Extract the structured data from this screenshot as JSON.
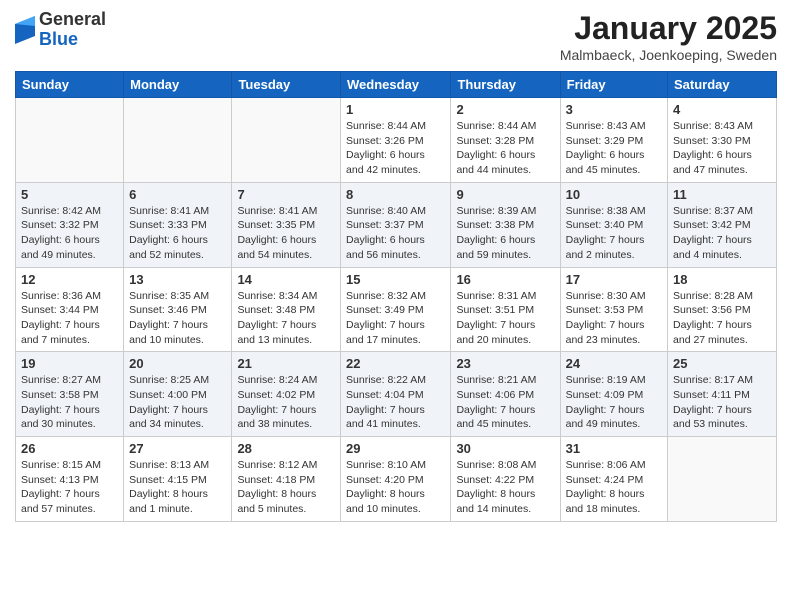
{
  "header": {
    "logo_general": "General",
    "logo_blue": "Blue",
    "month_title": "January 2025",
    "location": "Malmbaeck, Joenkoeping, Sweden"
  },
  "weekdays": [
    "Sunday",
    "Monday",
    "Tuesday",
    "Wednesday",
    "Thursday",
    "Friday",
    "Saturday"
  ],
  "weeks": [
    [
      {
        "day": "",
        "info": ""
      },
      {
        "day": "",
        "info": ""
      },
      {
        "day": "",
        "info": ""
      },
      {
        "day": "1",
        "info": "Sunrise: 8:44 AM\nSunset: 3:26 PM\nDaylight: 6 hours\nand 42 minutes."
      },
      {
        "day": "2",
        "info": "Sunrise: 8:44 AM\nSunset: 3:28 PM\nDaylight: 6 hours\nand 44 minutes."
      },
      {
        "day": "3",
        "info": "Sunrise: 8:43 AM\nSunset: 3:29 PM\nDaylight: 6 hours\nand 45 minutes."
      },
      {
        "day": "4",
        "info": "Sunrise: 8:43 AM\nSunset: 3:30 PM\nDaylight: 6 hours\nand 47 minutes."
      }
    ],
    [
      {
        "day": "5",
        "info": "Sunrise: 8:42 AM\nSunset: 3:32 PM\nDaylight: 6 hours\nand 49 minutes."
      },
      {
        "day": "6",
        "info": "Sunrise: 8:41 AM\nSunset: 3:33 PM\nDaylight: 6 hours\nand 52 minutes."
      },
      {
        "day": "7",
        "info": "Sunrise: 8:41 AM\nSunset: 3:35 PM\nDaylight: 6 hours\nand 54 minutes."
      },
      {
        "day": "8",
        "info": "Sunrise: 8:40 AM\nSunset: 3:37 PM\nDaylight: 6 hours\nand 56 minutes."
      },
      {
        "day": "9",
        "info": "Sunrise: 8:39 AM\nSunset: 3:38 PM\nDaylight: 6 hours\nand 59 minutes."
      },
      {
        "day": "10",
        "info": "Sunrise: 8:38 AM\nSunset: 3:40 PM\nDaylight: 7 hours\nand 2 minutes."
      },
      {
        "day": "11",
        "info": "Sunrise: 8:37 AM\nSunset: 3:42 PM\nDaylight: 7 hours\nand 4 minutes."
      }
    ],
    [
      {
        "day": "12",
        "info": "Sunrise: 8:36 AM\nSunset: 3:44 PM\nDaylight: 7 hours\nand 7 minutes."
      },
      {
        "day": "13",
        "info": "Sunrise: 8:35 AM\nSunset: 3:46 PM\nDaylight: 7 hours\nand 10 minutes."
      },
      {
        "day": "14",
        "info": "Sunrise: 8:34 AM\nSunset: 3:48 PM\nDaylight: 7 hours\nand 13 minutes."
      },
      {
        "day": "15",
        "info": "Sunrise: 8:32 AM\nSunset: 3:49 PM\nDaylight: 7 hours\nand 17 minutes."
      },
      {
        "day": "16",
        "info": "Sunrise: 8:31 AM\nSunset: 3:51 PM\nDaylight: 7 hours\nand 20 minutes."
      },
      {
        "day": "17",
        "info": "Sunrise: 8:30 AM\nSunset: 3:53 PM\nDaylight: 7 hours\nand 23 minutes."
      },
      {
        "day": "18",
        "info": "Sunrise: 8:28 AM\nSunset: 3:56 PM\nDaylight: 7 hours\nand 27 minutes."
      }
    ],
    [
      {
        "day": "19",
        "info": "Sunrise: 8:27 AM\nSunset: 3:58 PM\nDaylight: 7 hours\nand 30 minutes."
      },
      {
        "day": "20",
        "info": "Sunrise: 8:25 AM\nSunset: 4:00 PM\nDaylight: 7 hours\nand 34 minutes."
      },
      {
        "day": "21",
        "info": "Sunrise: 8:24 AM\nSunset: 4:02 PM\nDaylight: 7 hours\nand 38 minutes."
      },
      {
        "day": "22",
        "info": "Sunrise: 8:22 AM\nSunset: 4:04 PM\nDaylight: 7 hours\nand 41 minutes."
      },
      {
        "day": "23",
        "info": "Sunrise: 8:21 AM\nSunset: 4:06 PM\nDaylight: 7 hours\nand 45 minutes."
      },
      {
        "day": "24",
        "info": "Sunrise: 8:19 AM\nSunset: 4:09 PM\nDaylight: 7 hours\nand 49 minutes."
      },
      {
        "day": "25",
        "info": "Sunrise: 8:17 AM\nSunset: 4:11 PM\nDaylight: 7 hours\nand 53 minutes."
      }
    ],
    [
      {
        "day": "26",
        "info": "Sunrise: 8:15 AM\nSunset: 4:13 PM\nDaylight: 7 hours\nand 57 minutes."
      },
      {
        "day": "27",
        "info": "Sunrise: 8:13 AM\nSunset: 4:15 PM\nDaylight: 8 hours\nand 1 minute."
      },
      {
        "day": "28",
        "info": "Sunrise: 8:12 AM\nSunset: 4:18 PM\nDaylight: 8 hours\nand 5 minutes."
      },
      {
        "day": "29",
        "info": "Sunrise: 8:10 AM\nSunset: 4:20 PM\nDaylight: 8 hours\nand 10 minutes."
      },
      {
        "day": "30",
        "info": "Sunrise: 8:08 AM\nSunset: 4:22 PM\nDaylight: 8 hours\nand 14 minutes."
      },
      {
        "day": "31",
        "info": "Sunrise: 8:06 AM\nSunset: 4:24 PM\nDaylight: 8 hours\nand 18 minutes."
      },
      {
        "day": "",
        "info": ""
      }
    ]
  ]
}
